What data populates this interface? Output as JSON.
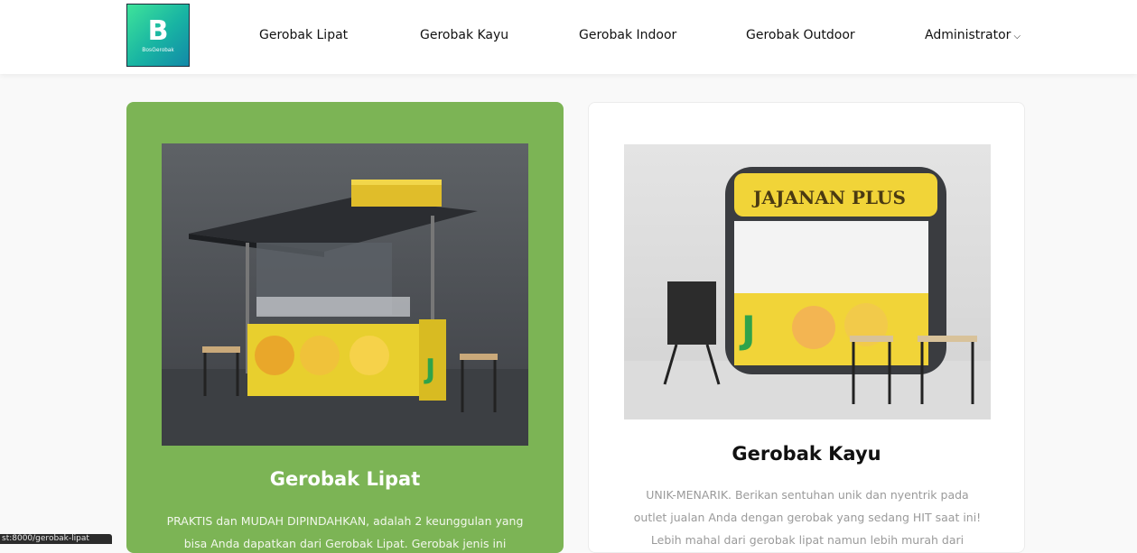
{
  "brand": {
    "letter": "B",
    "wordmark": "BosGerobak"
  },
  "nav": {
    "items": [
      "Gerobak Lipat",
      "Gerobak Kayu",
      "Gerobak Indoor",
      "Gerobak Outdoor"
    ],
    "admin_label": "Administrator",
    "admin_chevron": "⌵"
  },
  "cards": [
    {
      "title": "Gerobak Lipat",
      "desc": "PRAKTIS dan MUDAH DIPINDAHKAN, adalah 2 keunggulan yang bisa Anda dapatkan dari Gerobak Lipat. Gerobak jenis ini",
      "image_alt": "Gerobak lipat booth illustration",
      "highlighted": true
    },
    {
      "title": "Gerobak Kayu",
      "desc": "UNIK-MENARIK. Berikan sentuhan unik dan nyentrik pada outlet jualan Anda dengan gerobak yang sedang HIT saat ini! Lebih mahal dari gerobak lipat namun lebih murah dari Gerobak jenis...",
      "image_sign": "JAJANAN PLUS",
      "highlighted": false
    }
  ],
  "status_bar_url": "st:8000/gerobak-lipat",
  "colors": {
    "accent_green": "#7cb455",
    "logo_gradient_start": "#3ee39a",
    "logo_gradient_end": "#1289a8"
  }
}
